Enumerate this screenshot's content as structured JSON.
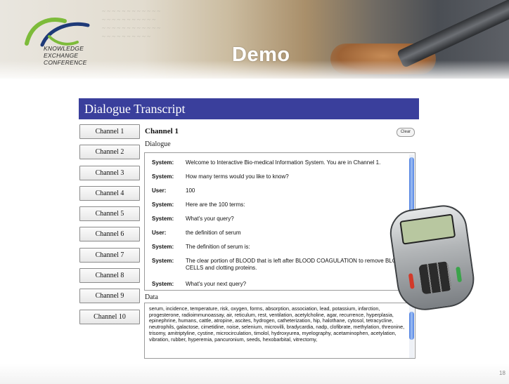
{
  "slide": {
    "title": "Demo",
    "page_number": "18",
    "logo": {
      "lines": [
        "KNOWLEDGE",
        "EXCHANGE",
        "CONFERENCE"
      ]
    }
  },
  "app": {
    "title": "Dialogue Transcript",
    "channels": [
      "Channel 1",
      "Channel 2",
      "Channel 3",
      "Channel 4",
      "Channel 5",
      "Channel 6",
      "Channel 7",
      "Channel 8",
      "Channel 9",
      "Channel 10"
    ],
    "current_channel": "Channel 1",
    "clear_label": "Clear",
    "dialogue_label": "Dialogue",
    "data_label": "Data",
    "dialogue": [
      {
        "speaker": "System:",
        "text": "Welcome to Interactive Bio-medical Information System. You are in Channel 1."
      },
      {
        "speaker": "System:",
        "text": "How many terms would you like to know?"
      },
      {
        "speaker": "User:",
        "text": "100"
      },
      {
        "speaker": "System:",
        "text": "Here are the 100 terms:"
      },
      {
        "speaker": "System:",
        "text": "What's your query?"
      },
      {
        "speaker": "User:",
        "text": "the definition of serum"
      },
      {
        "speaker": "System:",
        "text": "The definition of serum is:"
      },
      {
        "speaker": "System:",
        "text": "The clear portion of BLOOD that is left after BLOOD COAGULATION to remove BLOOD CELLS and clotting proteins."
      },
      {
        "speaker": "System:",
        "text": "What's your next query?"
      }
    ],
    "data_text": "serum, incidence, temperature, risk, oxygen, forms, absorption, association, lead, potassium, infarction, progesterone, radioimmunoassay, air, reticulum, rest, ventilation, acetylcholine, agar, recurrence, hyperplasia, epinephrine, humans, cattle, atropine, ascites, hydrogen, catheterization, hip, halothane, cytosol, tetracycline, neutrophils, galactose, cimetidine, noise, selenium, microvilli, bradycardia, nadp, clofibrate, methylation, threonine, trisomy, amitriptyline, cystine, microcirculation, timolol, hydroxyurea, myelography, acetaminophen, acetylation, vibration, rubber, hyperemia, pancuronium, seeds, hexobarbital, vitrectomy,"
  },
  "colors": {
    "title_bar": "#3a3f9c",
    "logo_accent": "#7dbb3a",
    "logo_dark": "#1f3a78"
  },
  "icons": [
    "conference-logo-icon",
    "phone-image"
  ]
}
